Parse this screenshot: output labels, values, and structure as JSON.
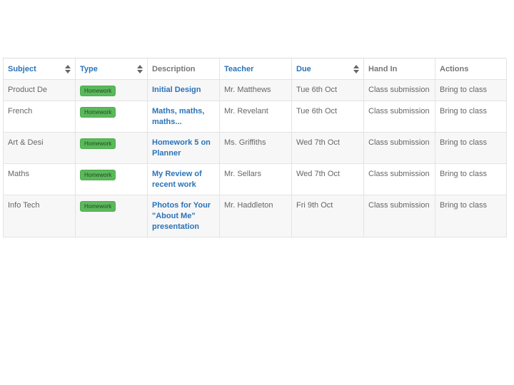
{
  "table": {
    "headers": {
      "subject": "Subject",
      "type": "Type",
      "description": "Description",
      "teacher": "Teacher",
      "due": "Due",
      "hand_in": "Hand In",
      "actions": "Actions"
    },
    "rows": [
      {
        "subject": "Product De",
        "type": "Homework",
        "description": "Initial Design",
        "teacher": "Mr. Matthews",
        "due": "Tue 6th Oct",
        "hand_in": "Class submission",
        "actions": "Bring to class"
      },
      {
        "subject": "French",
        "type": "Homework",
        "description": "Maths, maths, maths...",
        "teacher": "Mr. Revelant",
        "due": "Tue 6th Oct",
        "hand_in": "Class submission",
        "actions": "Bring to class"
      },
      {
        "subject": "Art & Desi",
        "type": "Homework",
        "description": "Homework 5 on Planner",
        "teacher": "Ms. Griffiths",
        "due": "Wed 7th Oct",
        "hand_in": "Class submission",
        "actions": "Bring to class"
      },
      {
        "subject": "Maths",
        "type": "Homework",
        "description": "My Review of recent work",
        "teacher": "Mr. Sellars",
        "due": "Wed 7th Oct",
        "hand_in": "Class submission",
        "actions": "Bring to class"
      },
      {
        "subject": "Info Tech",
        "type": "Homework",
        "description": "Photos for Your \"About Me\" presentation",
        "teacher": "Mr. Haddleton",
        "due": "Fri 9th Oct",
        "hand_in": "Class submission",
        "actions": "Bring to class"
      }
    ]
  },
  "colors": {
    "link": "#2a73b8",
    "badge": "#5cb85c",
    "row_alt": "#f7f7f7"
  },
  "icons": {
    "sort": "sort-arrows-icon"
  }
}
